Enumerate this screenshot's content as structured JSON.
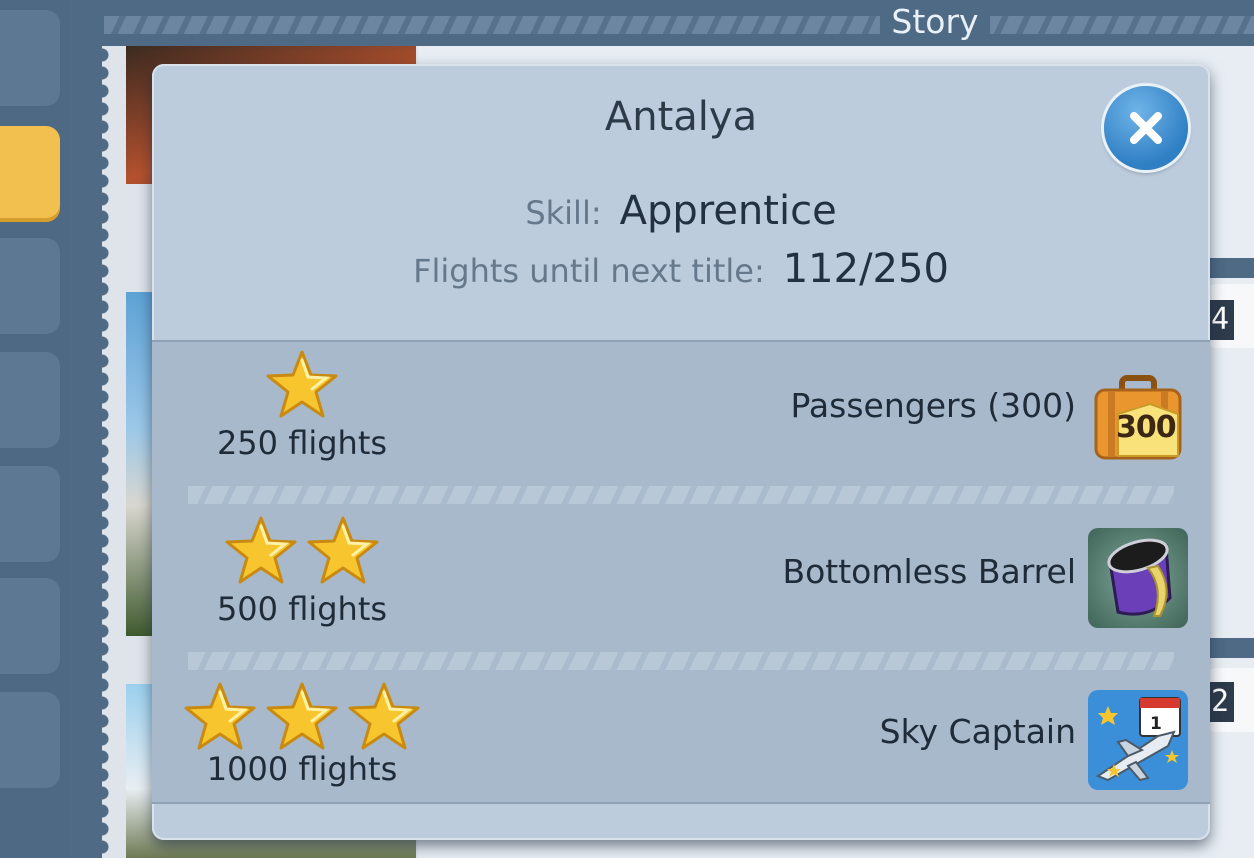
{
  "background": {
    "header_title": "Story",
    "counters": [
      "4",
      "2"
    ]
  },
  "dialog": {
    "title": "Antalya",
    "skill_label": "Skill:",
    "skill_value": "Apprentice",
    "progress_label": "Flights until next title:",
    "progress_value": "112/250",
    "close_icon": "close-icon",
    "rewards": [
      {
        "stars": 1,
        "flights_label": "250 flights",
        "name": "Passengers (300)",
        "icon": "suitcase-icon",
        "badge": "300"
      },
      {
        "stars": 2,
        "flights_label": "500 flights",
        "name": "Bottomless Barrel",
        "icon": "barrel-icon"
      },
      {
        "stars": 3,
        "flights_label": "1000 flights",
        "name": "Sky Captain",
        "icon": "airplane-calendar-icon",
        "badge": "1"
      }
    ]
  },
  "colors": {
    "accent_tab": "#f2c04e",
    "close_button": "#2f7fc4",
    "star_gold": "#f7c62f",
    "dialog_bg": "#bcccdd"
  }
}
